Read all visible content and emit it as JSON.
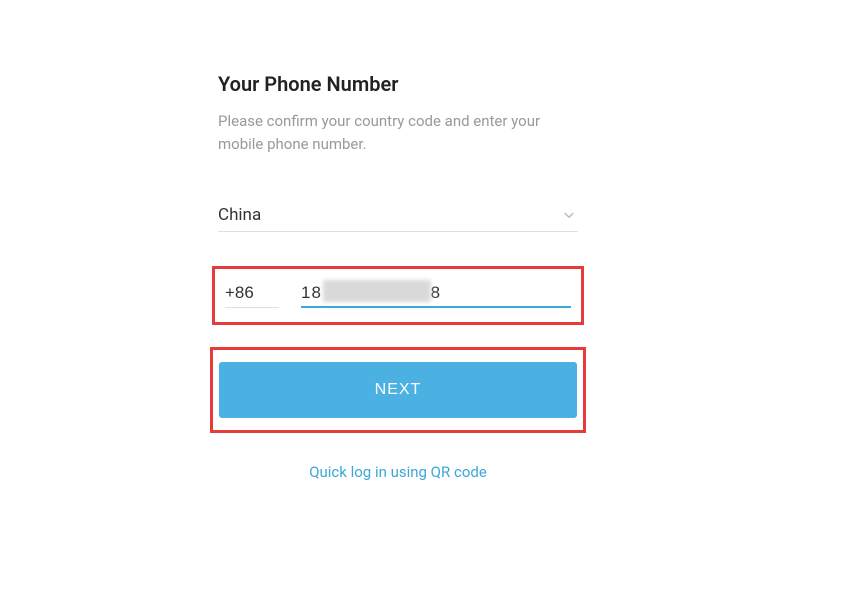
{
  "title": "Your Phone Number",
  "subtitle": "Please confirm your country code and enter your mobile phone number.",
  "country": "China",
  "phone": {
    "code": "+86",
    "number": "18                   8"
  },
  "next_label": "NEXT",
  "qr_link_label": "Quick log in using QR code",
  "colors": {
    "accent": "#3ca7d9",
    "button": "#4bb0e2",
    "highlight": "#e63b3b"
  }
}
